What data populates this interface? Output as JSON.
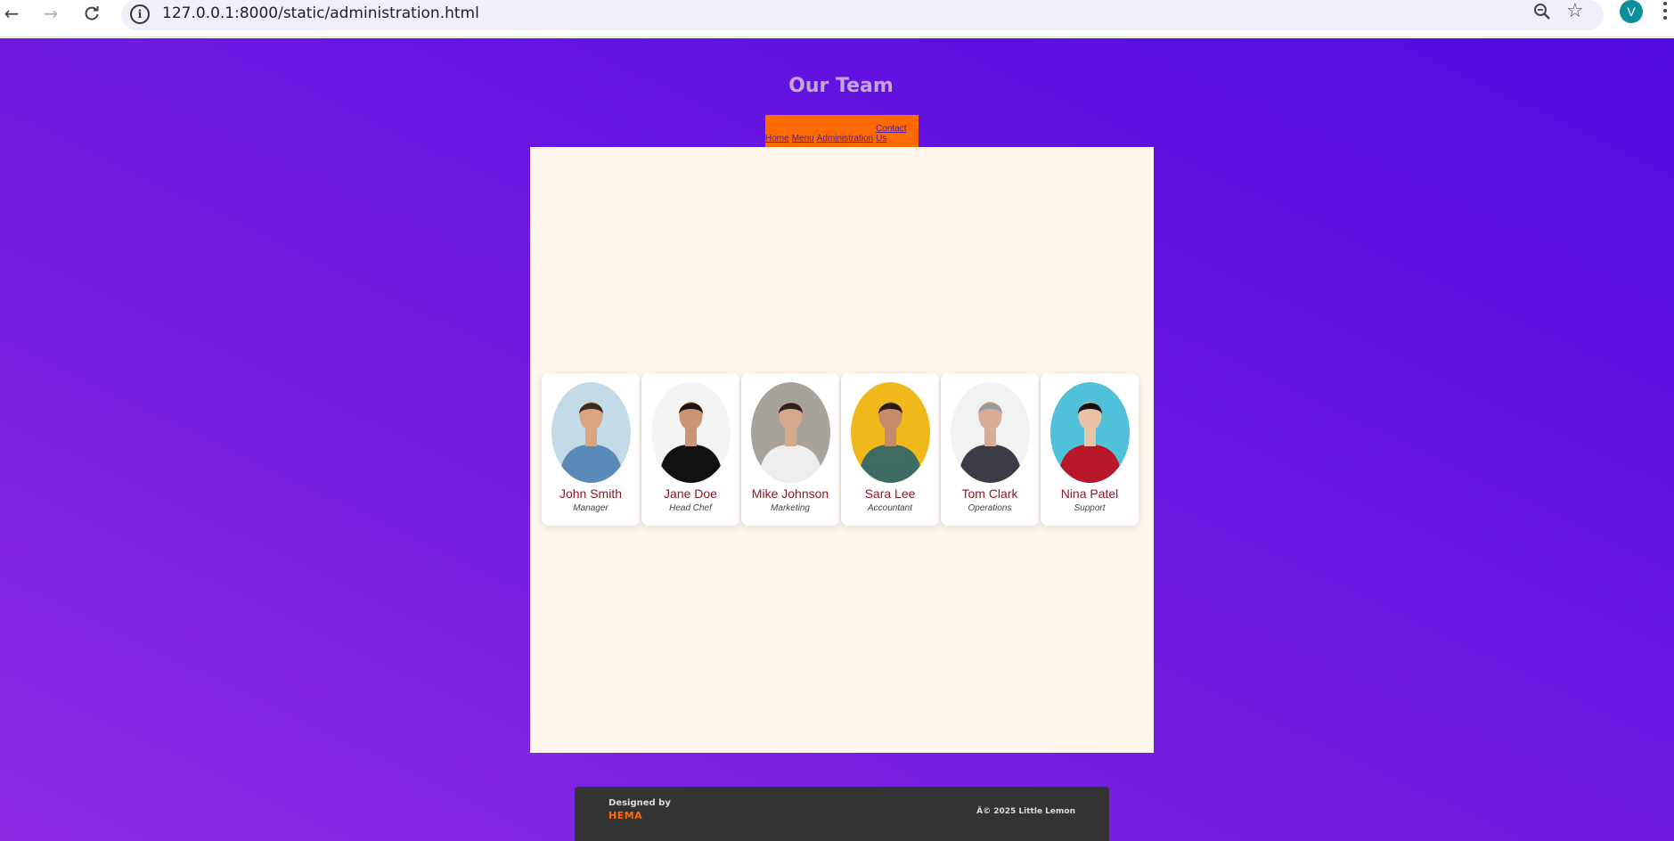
{
  "browser": {
    "url": "127.0.0.1:8000/static/administration.html",
    "avatar_letter": "V",
    "icons": [
      "back-arrow-icon",
      "forward-arrow-icon",
      "reload-icon",
      "site-info-icon",
      "zoom-icon",
      "bookmark-star-icon",
      "profile-avatar",
      "kebab-menu-icon"
    ]
  },
  "page": {
    "title": "Our Team",
    "nav": [
      {
        "label": "Home"
      },
      {
        "label": "Menu"
      },
      {
        "label": "Administration"
      },
      {
        "label": "Contact Us"
      }
    ]
  },
  "team": [
    {
      "name": "John Smith",
      "role": "Manager",
      "bg": "#c3dbe6",
      "shirt": "#5a8ab8",
      "skin": "#d9a47f",
      "hair": "#3a2a20"
    },
    {
      "name": "Jane Doe",
      "role": "Head Chef",
      "bg": "#f4f4f4",
      "shirt": "#111111",
      "skin": "#c99575",
      "hair": "#1d1510"
    },
    {
      "name": "Mike Johnson",
      "role": "Marketing",
      "bg": "#a8a29c",
      "shirt": "#eeeeee",
      "skin": "#d7a98c",
      "hair": "#2d241c"
    },
    {
      "name": "Sara Lee",
      "role": "Accountant",
      "bg": "#f0b81a",
      "shirt": "#3e6b62",
      "skin": "#c48c6a",
      "hair": "#2a1a12"
    },
    {
      "name": "Tom Clark",
      "role": "Operations",
      "bg": "#f2f2f2",
      "shirt": "#3a3d44",
      "skin": "#d8ad93",
      "hair": "#9a9a9a"
    },
    {
      "name": "Nina Patel",
      "role": "Support",
      "bg": "#4fc1d8",
      "shirt": "#b8162a",
      "skin": "#eac2a5",
      "hair": "#1a1210"
    }
  ],
  "footer": {
    "designed_by": "Designed by",
    "designer": "HEMA",
    "copyright": "Â© 2025 Little Lemon"
  },
  "colors": {
    "gradient_start": "#8a2be2",
    "gradient_end": "#5209e0",
    "nav_bg": "#ff6a00",
    "content_bg": "#fff6ee",
    "name_color": "#8b1a2b",
    "footer_bg": "#333333"
  }
}
